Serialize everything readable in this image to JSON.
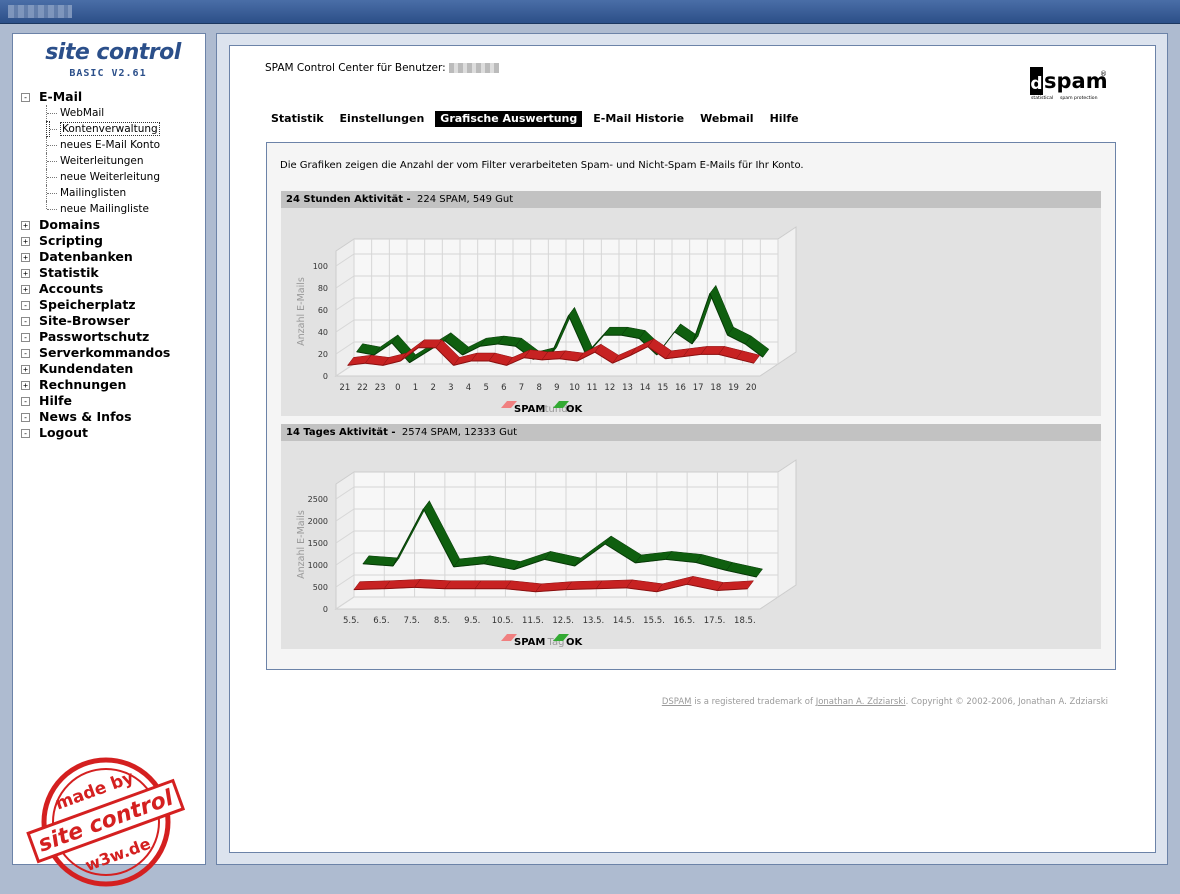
{
  "sidebar": {
    "logo_title": "site control",
    "logo_version": "BASIC V2.61",
    "email_section": "E-Mail",
    "email_items": [
      "WebMail",
      "Kontenverwaltung",
      "neues E-Mail Konto",
      "Weiterleitungen",
      "neue Weiterleitung",
      "Mailinglisten",
      "neue Mailingliste"
    ],
    "sections": [
      "Domains",
      "Scripting",
      "Datenbanken",
      "Statistik",
      "Accounts",
      "Speicherplatz",
      "Site-Browser",
      "Passwortschutz",
      "Serverkommandos",
      "Kundendaten",
      "Rechnungen",
      "Hilfe",
      "News & Infos",
      "Logout"
    ],
    "stamp_top": "made by",
    "stamp_middle": "site control",
    "stamp_bottom": "w3w.de"
  },
  "header": {
    "text": "SPAM Control Center für Benutzer:",
    "logo_text": "spam",
    "logo_letter": "d",
    "logo_sub1": "statistical",
    "logo_sub2": "spam protection",
    "logo_reg": "®"
  },
  "tabs": [
    "Statistik",
    "Einstellungen",
    "Grafische Auswertung",
    "E-Mail Historie",
    "Webmail",
    "Hilfe"
  ],
  "intro": "Die Grafiken zeigen die Anzahl der vom Filter verarbeiteten Spam- und Nicht-Spam E-Mails für Ihr Konto.",
  "chart1_header": {
    "title": "24 Stunden Aktivität -",
    "summary": "224 SPAM,  549 Gut"
  },
  "chart2_header": {
    "title": "14 Tages Aktivität -",
    "summary": "2574 SPAM,  12333 Gut"
  },
  "footer": {
    "dspam": "DSPAM",
    "mid": " is a registered trademark of ",
    "author": "Jonathan A. Zdziarski",
    "rest": ". Copyright © 2002-2006, Jonathan A. Zdziarski"
  },
  "colors": {
    "spam": "#cc1f1f",
    "ok": "#0d5c0d",
    "accent": "#2b4f8a"
  },
  "chart_data": [
    {
      "type": "area",
      "categories": [
        "21",
        "22",
        "23",
        "0",
        "1",
        "2",
        "3",
        "4",
        "5",
        "6",
        "7",
        "8",
        "9",
        "10",
        "11",
        "12",
        "13",
        "14",
        "15",
        "16",
        "17",
        "18",
        "19",
        "20"
      ],
      "series": [
        {
          "name": "SPAM",
          "values": [
            8,
            10,
            8,
            12,
            24,
            24,
            8,
            12,
            12,
            8,
            15,
            13,
            14,
            12,
            20,
            10,
            17,
            25,
            14,
            16,
            18,
            18,
            14,
            10
          ]
        },
        {
          "name": "OK",
          "values": [
            15,
            12,
            23,
            5,
            15,
            25,
            12,
            20,
            22,
            20,
            8,
            12,
            48,
            12,
            30,
            30,
            27,
            12,
            33,
            22,
            68,
            30,
            22,
            10
          ]
        }
      ],
      "xlabel": "Stunde",
      "ylabel": "Anzahl E-Mails",
      "yticks": [
        "0",
        "20",
        "40",
        "60",
        "80",
        "100"
      ],
      "ylim": [
        0,
        100
      ],
      "grid": true,
      "legend": "bottom"
    },
    {
      "type": "area",
      "categories": [
        "5.5.",
        "6.5.",
        "7.5.",
        "8.5.",
        "9.5.",
        "10.5.",
        "11.5.",
        "12.5.",
        "13.5.",
        "14.5.",
        "15.5.",
        "16.5.",
        "17.5.",
        "18.5."
      ],
      "series": [
        {
          "name": "SPAM",
          "values": [
            400,
            420,
            450,
            420,
            420,
            420,
            350,
            400,
            420,
            440,
            350,
            520,
            380,
            420
          ]
        },
        {
          "name": "OK",
          "values": [
            850,
            800,
            2100,
            780,
            850,
            720,
            950,
            800,
            1300,
            870,
            950,
            880,
            700,
            550
          ]
        }
      ],
      "xlabel": "Tag",
      "ylabel": "Anzahl E-Mails",
      "yticks": [
        "0",
        "500",
        "1000",
        "1500",
        "2000",
        "2500"
      ],
      "ylim": [
        0,
        2500
      ],
      "grid": true,
      "legend": "bottom"
    }
  ]
}
